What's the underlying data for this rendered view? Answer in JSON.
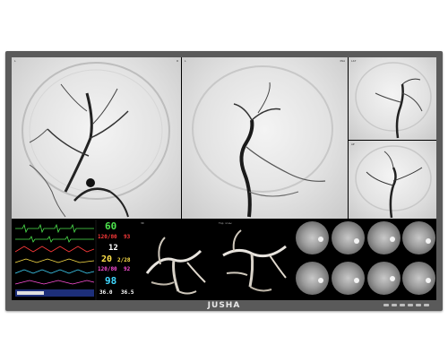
{
  "brand": "JUSHA",
  "overlay_text": {
    "pane1": [
      "L",
      "R"
    ],
    "pane2": [
      "L",
      "DSA"
    ],
    "pane3": "LAT",
    "pane4": "AP",
    "pane_3d_a": "3D",
    "pane_3d_b": "Top view"
  },
  "monitor": {
    "hr": "60",
    "nibp": "120/80",
    "nibp_aux": "93",
    "rr": "12",
    "ibp": "20",
    "ibp_aux": "2/28",
    "art": "120/80",
    "art_aux": "92",
    "spo2": "98",
    "temp1": "36.0",
    "temp2": "36.5"
  },
  "colors": {
    "green": "#4ee64e",
    "red": "#ff3b3b",
    "cyan": "#40d8ff",
    "yellow": "#ffe24a",
    "magenta": "#ff4fd8",
    "white": "#ffffff",
    "bezel": "#5a5a5a"
  }
}
